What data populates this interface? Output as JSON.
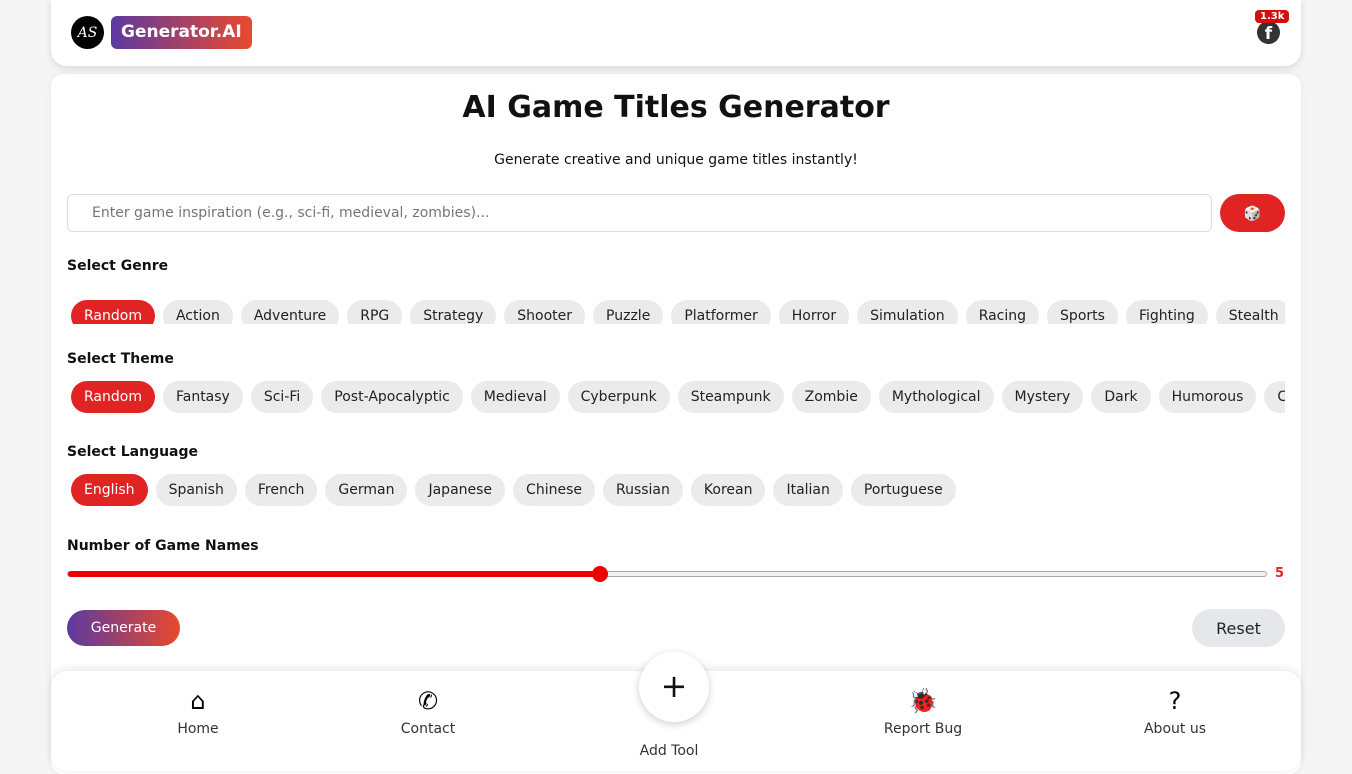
{
  "header": {
    "logo_text": "AS",
    "brand": "Generator.AI",
    "facebook_count": "1.3k"
  },
  "main": {
    "title": "AI Game Titles Generator",
    "subtitle": "Generate creative and unique game titles instantly!",
    "input_placeholder": "Enter game inspiration (e.g., sci-fi, medieval, zombies)...",
    "genre_label": "Select Genre",
    "genres": [
      "Random",
      "Action",
      "Adventure",
      "RPG",
      "Strategy",
      "Shooter",
      "Puzzle",
      "Platformer",
      "Horror",
      "Simulation",
      "Racing",
      "Sports",
      "Fighting",
      "Stealth",
      ""
    ],
    "theme_label": "Select Theme",
    "themes": [
      "Random",
      "Fantasy",
      "Sci-Fi",
      "Post-Apocalyptic",
      "Medieval",
      "Cyberpunk",
      "Steampunk",
      "Zombie",
      "Mythological",
      "Mystery",
      "Dark",
      "Humorous",
      "Cute"
    ],
    "language_label": "Select Language",
    "languages": [
      "English",
      "Spanish",
      "French",
      "German",
      "Japanese",
      "Chinese",
      "Russian",
      "Korean",
      "Italian",
      "Portuguese"
    ],
    "count_label": "Number of Game Names",
    "count_value": "5",
    "count_min": 1,
    "count_max": 10,
    "generate": "Generate",
    "reset": "Reset",
    "accent": "#e02424"
  },
  "nav": {
    "home": "Home",
    "contact": "Contact",
    "add": "Add Tool",
    "bug": "Report Bug",
    "about": "About us"
  }
}
